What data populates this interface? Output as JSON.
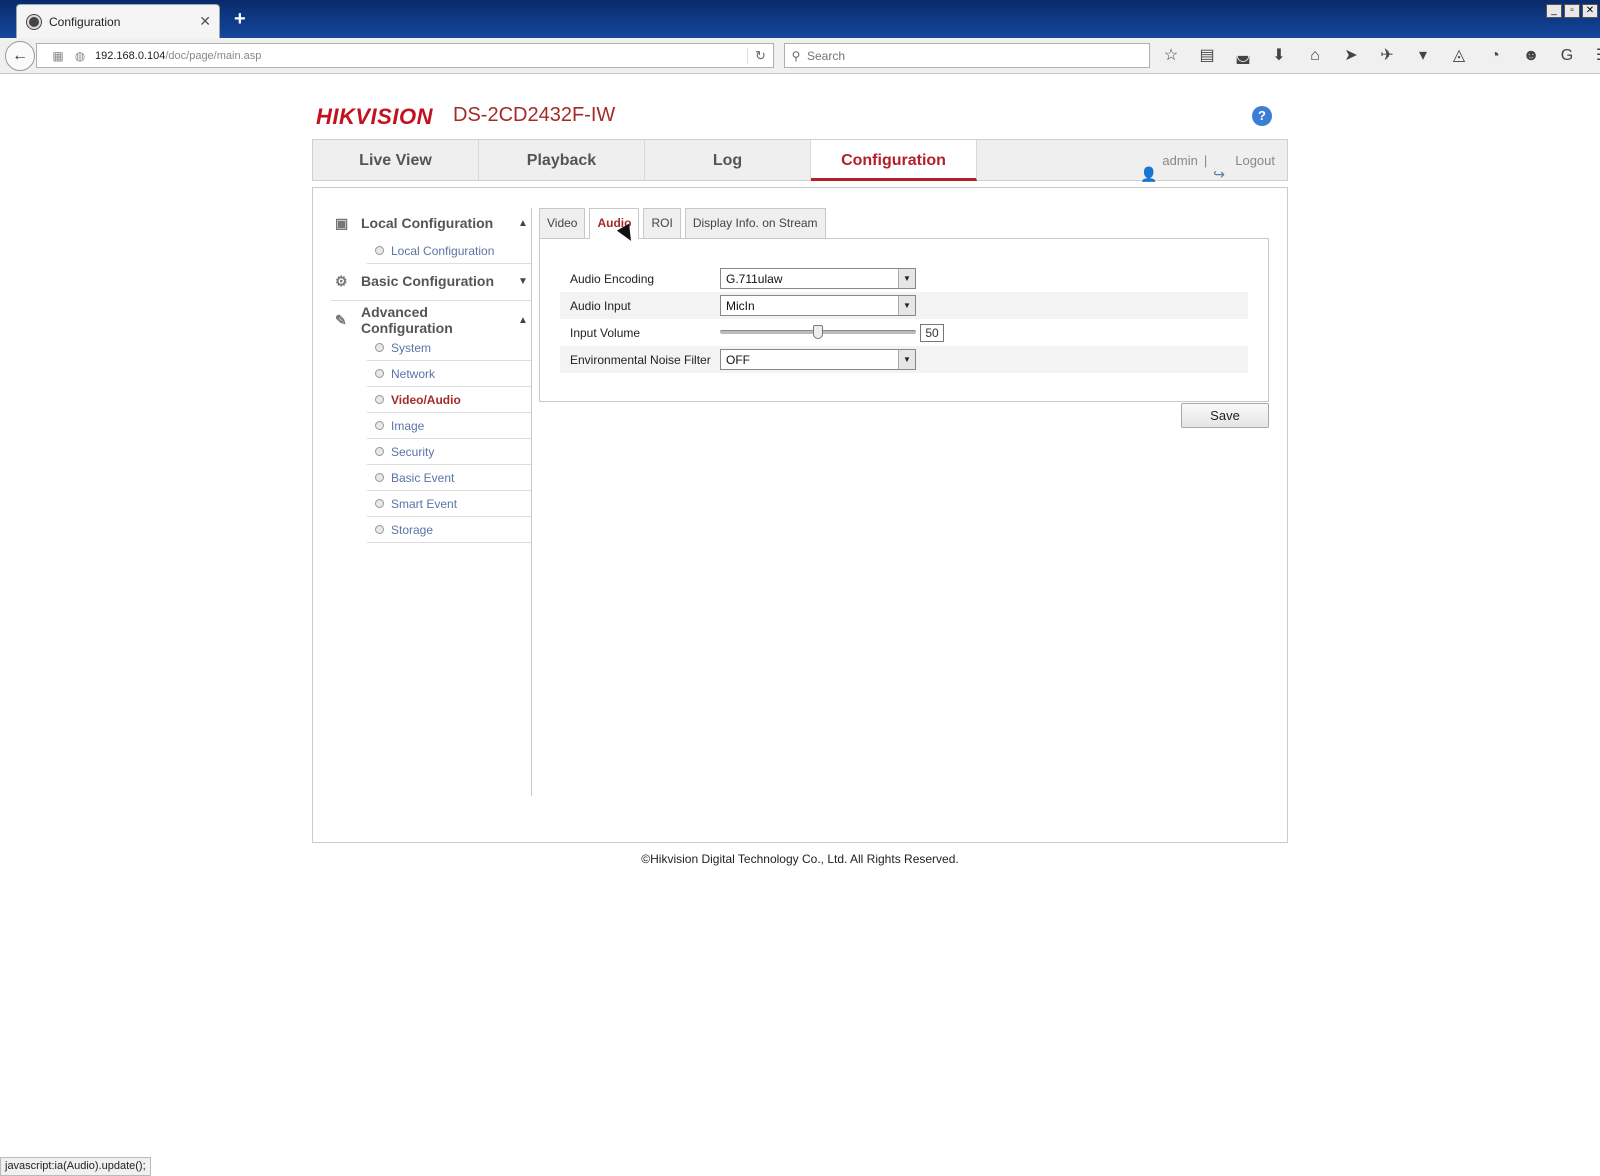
{
  "browser": {
    "tab_title": "Configuration",
    "new_tab": "+",
    "url_host": "192.168.0.104",
    "url_path": "/doc/page/main.asp",
    "search_placeholder": "Search",
    "window_buttons": [
      "_",
      "▫",
      "✕"
    ],
    "status_text": "javascript:ia(Audio).update();"
  },
  "header": {
    "brand": "HIKVISION",
    "model": "DS-2CD2432F-IW",
    "help": "?"
  },
  "mainnav": {
    "tabs": [
      "Live View",
      "Playback",
      "Log",
      "Configuration"
    ],
    "active": "Configuration",
    "user": "admin",
    "separator": "|",
    "logout": "Logout"
  },
  "sidebar": {
    "local_config": {
      "label": "Local Configuration",
      "items": [
        "Local Configuration"
      ]
    },
    "basic_config": {
      "label": "Basic Configuration"
    },
    "advanced_config": {
      "label": "Advanced Configuration",
      "items": [
        "System",
        "Network",
        "Video/Audio",
        "Image",
        "Security",
        "Basic Event",
        "Smart Event",
        "Storage"
      ]
    },
    "active_item": "Video/Audio"
  },
  "content": {
    "subtabs": [
      "Video",
      "Audio",
      "ROI",
      "Display Info. on Stream"
    ],
    "active_subtab": "Audio",
    "form": {
      "audio_encoding": {
        "label": "Audio Encoding",
        "value": "G.711ulaw"
      },
      "audio_input": {
        "label": "Audio Input",
        "value": "MicIn"
      },
      "input_volume": {
        "label": "Input Volume",
        "value": "50",
        "level": 0.5
      },
      "noise_filter": {
        "label": "Environmental Noise Filter",
        "value": "OFF"
      }
    },
    "save_label": "Save"
  },
  "footer": "©Hikvision Digital Technology Co., Ltd. All Rights Reserved."
}
